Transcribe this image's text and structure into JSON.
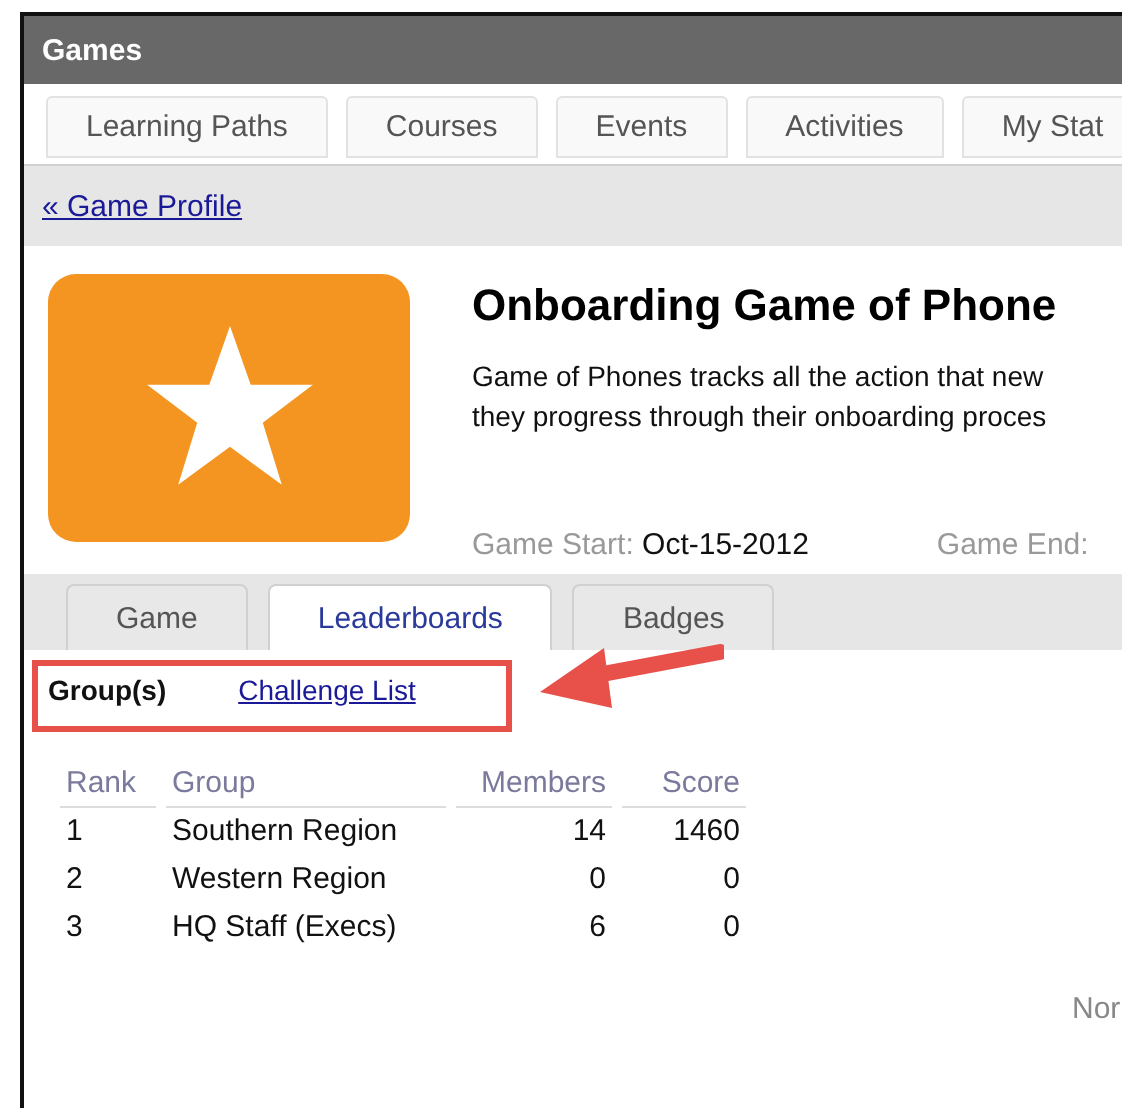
{
  "window": {
    "title": "Games"
  },
  "nav_tabs": [
    {
      "label": "Learning Paths"
    },
    {
      "label": "Courses"
    },
    {
      "label": "Events"
    },
    {
      "label": "Activities"
    },
    {
      "label": "My Stat"
    }
  ],
  "back_link": "« Game Profile",
  "game": {
    "title": "Onboarding Game of Phone",
    "description": [
      "Game of Phones tracks all the action that new",
      "they progress through their onboarding proces"
    ],
    "start_label": "Game Start:",
    "start_value": "Oct-15-2012",
    "end_label": "Game End:"
  },
  "sub_tabs": [
    {
      "label": "Game",
      "selected": false
    },
    {
      "label": "Leaderboards",
      "selected": true
    },
    {
      "label": "Badges",
      "selected": false
    }
  ],
  "view_switch": [
    {
      "label": "Group(s)",
      "selected": true
    },
    {
      "label": "Challenge List",
      "selected": false
    }
  ],
  "table": {
    "columns": [
      "Rank",
      "Group",
      "Members",
      "Score"
    ],
    "rows": [
      [
        "1",
        "Southern Region",
        "14",
        "1460"
      ],
      [
        "2",
        "Western Region",
        "0",
        "0"
      ],
      [
        "3",
        "HQ Staff (Execs)",
        "6",
        "0"
      ]
    ]
  },
  "footer_text": "Nor"
}
